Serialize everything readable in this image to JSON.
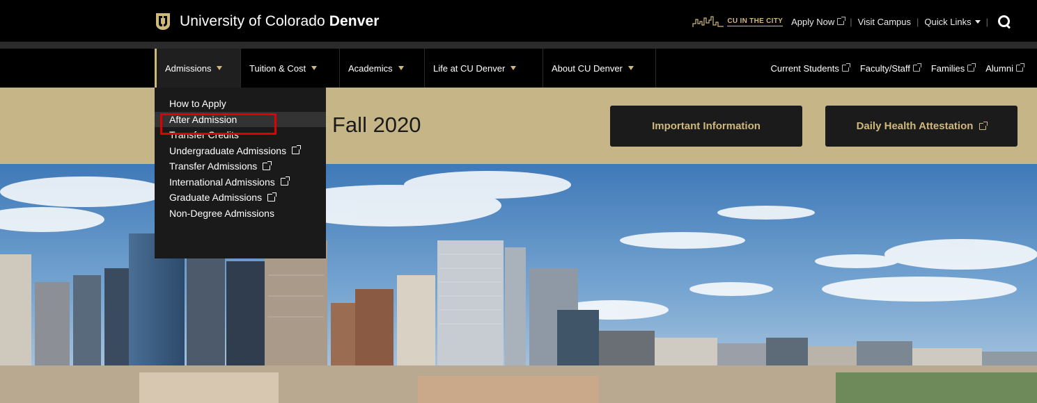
{
  "brand": {
    "name_regular": "University of Colorado ",
    "name_bold": "Denver",
    "logo_icon": "cu-logo-icon"
  },
  "utility": {
    "cu_in_the_city": "CU IN THE CITY",
    "apply_now": "Apply Now",
    "visit_campus": "Visit Campus",
    "quick_links": "Quick Links"
  },
  "nav": {
    "items": [
      {
        "label": "Admissions"
      },
      {
        "label": "Tuition & Cost"
      },
      {
        "label": "Academics"
      },
      {
        "label": "Life at CU Denver"
      },
      {
        "label": "About CU Denver"
      }
    ],
    "right_links": [
      {
        "label": "Current Students"
      },
      {
        "label": "Faculty/Staff"
      },
      {
        "label": "Families"
      },
      {
        "label": "Alumni"
      }
    ]
  },
  "dropdown": {
    "items": [
      {
        "label": "How to Apply"
      },
      {
        "label": "After Admission"
      },
      {
        "label": "Transfer Credits"
      },
      {
        "label": "Undergraduate Admissions"
      },
      {
        "label": "Transfer Admissions"
      },
      {
        "label": "International Admissions"
      },
      {
        "label": "Graduate Admissions"
      },
      {
        "label": "Non-Degree Admissions"
      }
    ]
  },
  "banner": {
    "title": "Fall 2020",
    "important_info": "Important Information",
    "daily_health": "Daily Health Attestation"
  },
  "colors": {
    "gold": "#cfb87c",
    "banner": "#c5b587",
    "highlight": "#e00000"
  }
}
